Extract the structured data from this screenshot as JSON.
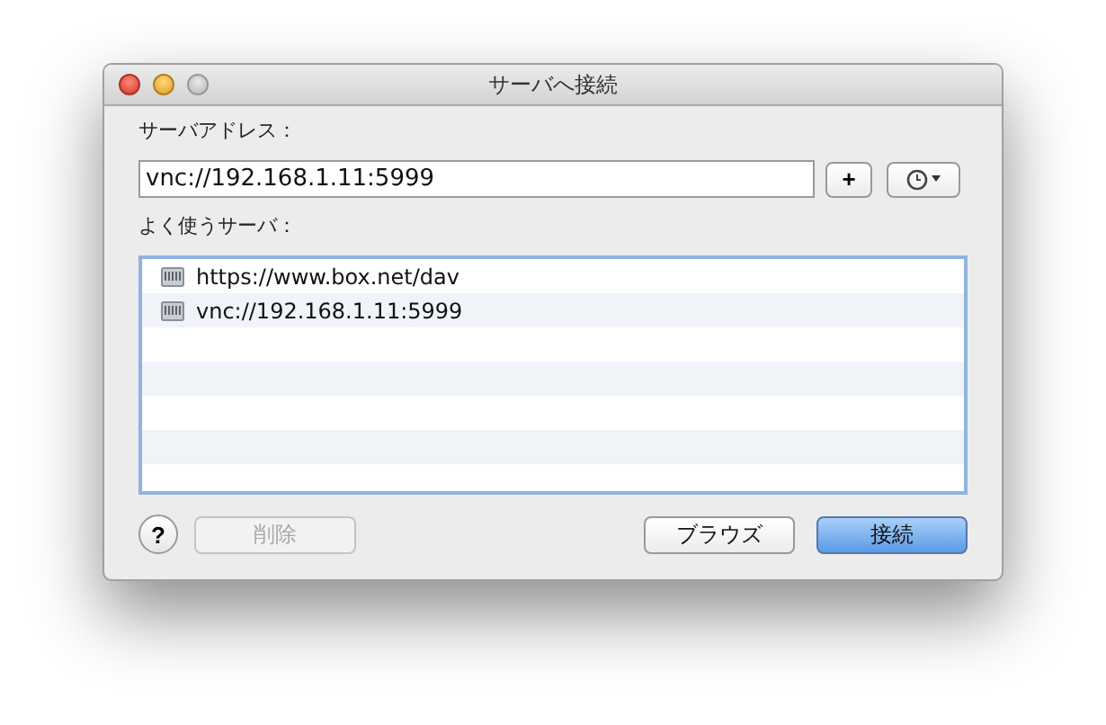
{
  "window": {
    "title": "サーバへ接続"
  },
  "server_address": {
    "label": "サーバアドレス：",
    "value": "vnc://192.168.1.11:5999"
  },
  "add_button": {
    "label": "+"
  },
  "favorites": {
    "label": "よく使うサーバ：",
    "items": [
      {
        "text": "https://www.box.net/dav"
      },
      {
        "text": "vnc://192.168.1.11:5999"
      }
    ]
  },
  "help_button": {
    "label": "?"
  },
  "buttons": [
    {
      "label": "削除",
      "disabled": true,
      "default": false
    },
    {
      "label": "ブラウズ",
      "disabled": false,
      "default": false
    },
    {
      "label": "接続",
      "disabled": false,
      "default": true
    }
  ]
}
